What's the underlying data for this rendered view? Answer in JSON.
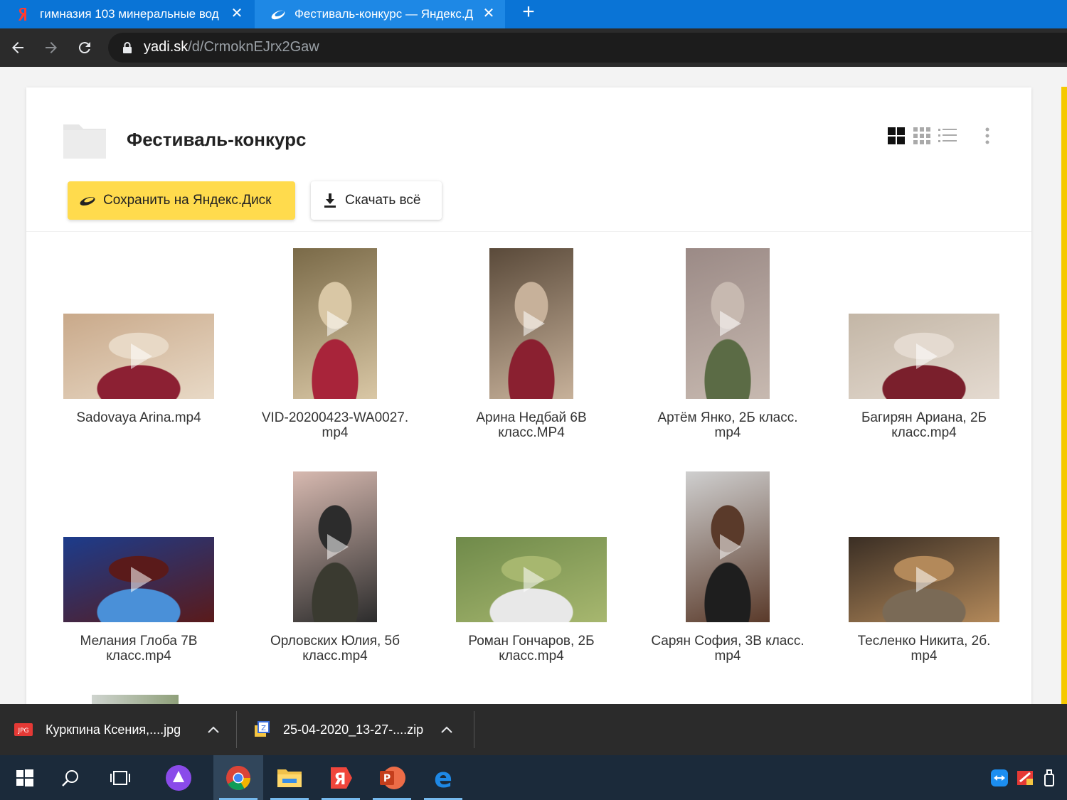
{
  "browser": {
    "tabs": [
      {
        "title": "гимназия 103 минеральные вод",
        "icon": "yandex-icon",
        "active": false
      },
      {
        "title": "Фестиваль-конкурс — Яндекс.Д",
        "icon": "yandex-disk-icon",
        "active": true
      }
    ],
    "url_host": "yadi.sk",
    "url_path": "/d/CrmoknEJrx2Gaw"
  },
  "folder": {
    "title": "Фестиваль-конкурс",
    "save_label": "Сохранить на Яндекс.Диск",
    "download_label": "Скачать всё"
  },
  "files": [
    {
      "name": "Sadovaya Arina.mp4",
      "thumb_colors": [
        "#c9a98a",
        "#8c2033",
        "#e8d9c6"
      ],
      "orientation": "landscape"
    },
    {
      "name": "VID-20200423-WA0027.\nmp4",
      "thumb_colors": [
        "#7a6a48",
        "#a8243a",
        "#d9c7a5"
      ],
      "orientation": "portrait"
    },
    {
      "name": "Арина Недбай 6В\nкласс.MP4",
      "thumb_colors": [
        "#5a4a3a",
        "#8a2030",
        "#c7b19a"
      ],
      "orientation": "portrait"
    },
    {
      "name": "Артём Янко, 2Б класс.\nmp4",
      "thumb_colors": [
        "#9b8a86",
        "#5b6b45",
        "#c7b9b0"
      ],
      "orientation": "portrait"
    },
    {
      "name": "Багирян Ариана, 2Б\nкласс.mp4",
      "thumb_colors": [
        "#c3b6a6",
        "#7a1f2c",
        "#e4dad0"
      ],
      "orientation": "landscape"
    },
    {
      "name": "Мелания Глоба 7В\nкласс.mp4",
      "thumb_colors": [
        "#1c3c8c",
        "#4a90d8",
        "#5a1a1a"
      ],
      "orientation": "landscape"
    },
    {
      "name": "Орловских Юлия, 5б\nкласс.mp4",
      "thumb_colors": [
        "#d7b9b0",
        "#3a3a30",
        "#2c2c2c"
      ],
      "orientation": "portrait"
    },
    {
      "name": "Роман Гончаров, 2Б\nкласс.mp4",
      "thumb_colors": [
        "#6f8a4a",
        "#e8e8e8",
        "#a7b76f"
      ],
      "orientation": "landscape"
    },
    {
      "name": "Сарян София, 3В класс.\nmp4",
      "thumb_colors": [
        "#cfcfcf",
        "#1e1e1e",
        "#5a3a2a"
      ],
      "orientation": "portrait"
    },
    {
      "name": "Тесленко Никита, 2б.\nmp4",
      "thumb_colors": [
        "#3a2e24",
        "#7a6a56",
        "#b3895a"
      ],
      "orientation": "landscape"
    }
  ],
  "downloads": [
    {
      "name": "Куркпина Ксения,....jpg",
      "icon": "jpg-file-icon"
    },
    {
      "name": "25-04-2020_13-27-....zip",
      "icon": "zip-file-icon"
    }
  ],
  "taskbar": [
    {
      "name": "windows-start-icon"
    },
    {
      "name": "search-icon"
    },
    {
      "name": "task-view-icon"
    },
    {
      "name": "alice-icon"
    },
    {
      "name": "chrome-icon"
    },
    {
      "name": "file-explorer-icon"
    },
    {
      "name": "yandex-browser-icon"
    },
    {
      "name": "powerpoint-icon"
    },
    {
      "name": "edge-icon"
    }
  ],
  "colors": {
    "tab_strip": "#0a74d6",
    "accent_yellow": "#ffdb4d",
    "scrollbar": "#f5c900"
  }
}
